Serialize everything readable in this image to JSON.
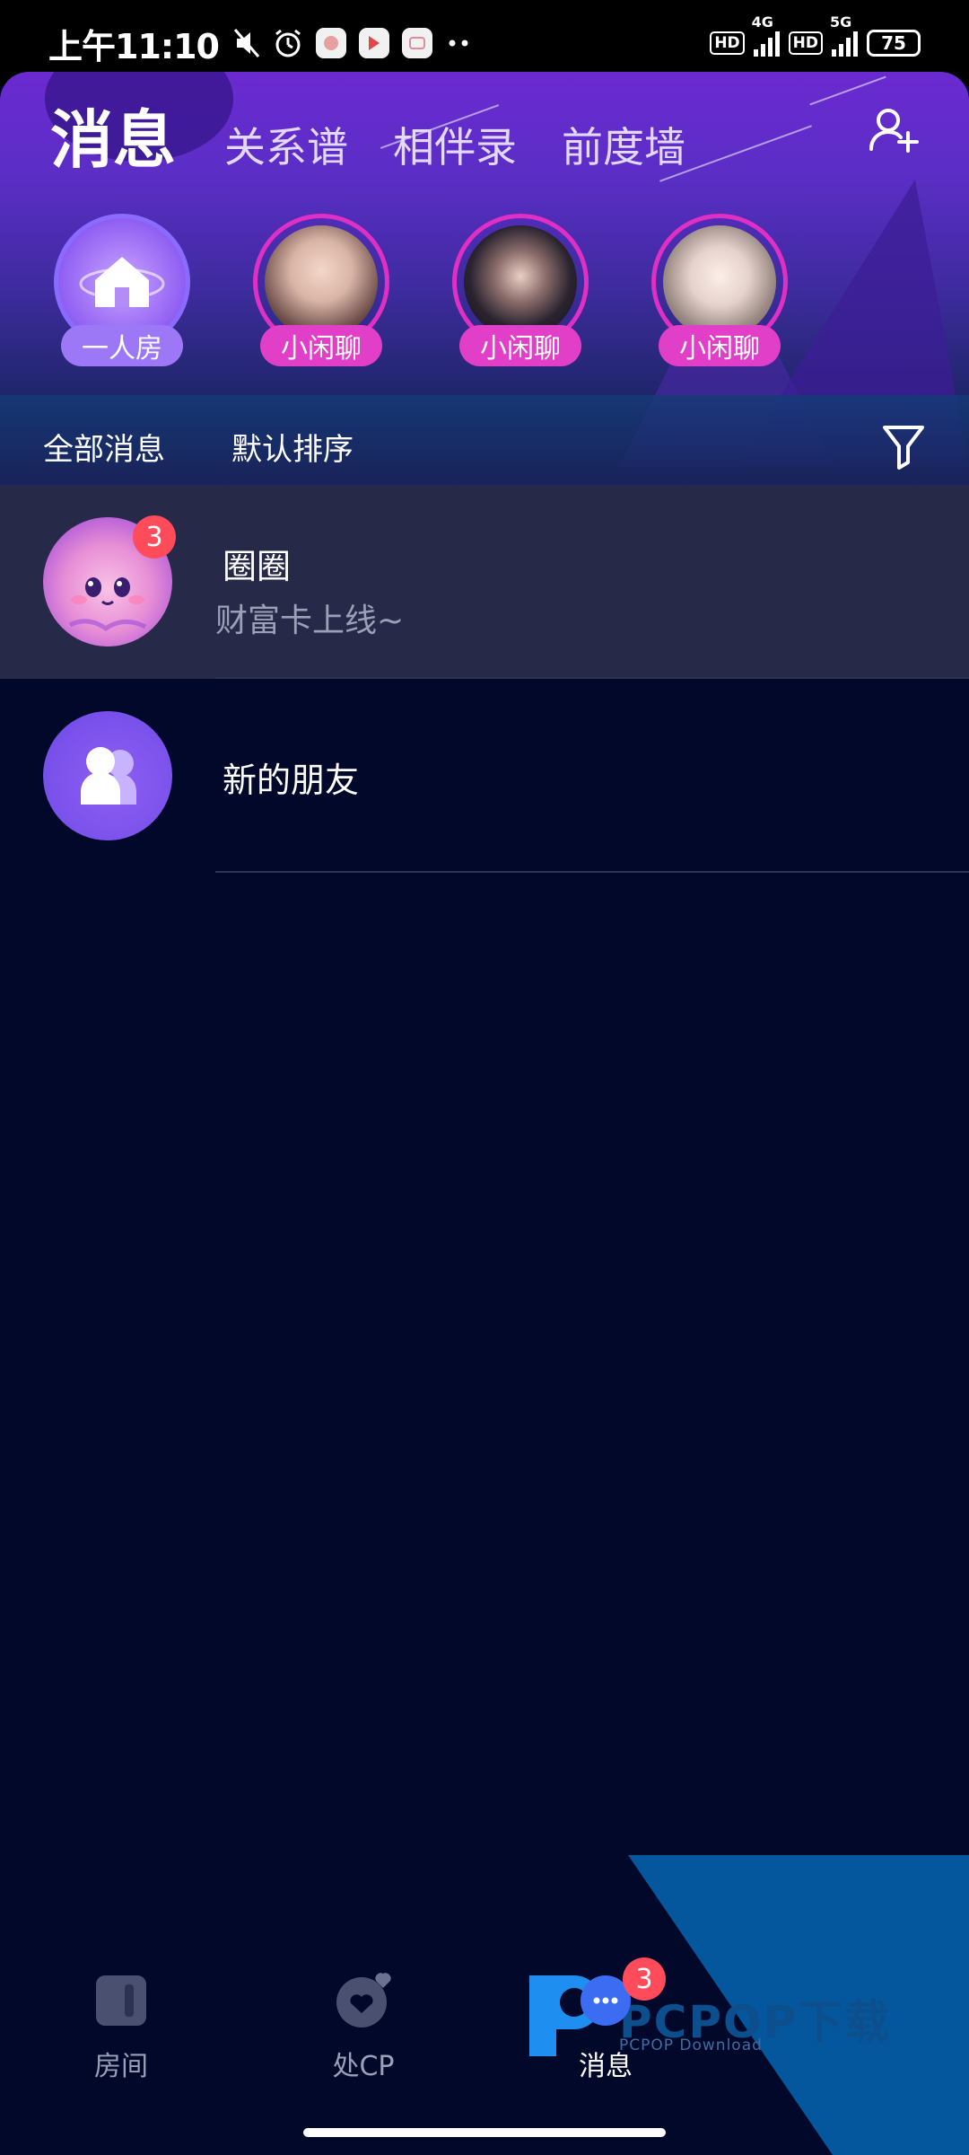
{
  "status_bar": {
    "time": "上午11:10",
    "battery": "75",
    "network_1": "4G",
    "network_2": "5G",
    "hd": "HD"
  },
  "header": {
    "tabs": [
      {
        "label": "消息",
        "active": true
      },
      {
        "label": "关系谱",
        "active": false
      },
      {
        "label": "相伴录",
        "active": false
      },
      {
        "label": "前度墙",
        "active": false
      }
    ],
    "add_friend_icon": "add-user-icon"
  },
  "rooms": [
    {
      "label": "一人房",
      "type": "home"
    },
    {
      "label": "小闲聊",
      "type": "chat"
    },
    {
      "label": "小闲聊",
      "type": "chat"
    },
    {
      "label": "小闲聊",
      "type": "chat"
    }
  ],
  "sort_bar": {
    "all_messages": "全部消息",
    "default_sort": "默认排序",
    "filter_icon": "filter-icon"
  },
  "messages": [
    {
      "name": "圈圈",
      "preview": "财富卡上线~",
      "badge": "3"
    },
    {
      "name": "新的朋友",
      "preview": ""
    }
  ],
  "bottom_nav": [
    {
      "label": "房间",
      "icon": "room-icon",
      "active": false
    },
    {
      "label": "处CP",
      "icon": "heart-icon",
      "active": false
    },
    {
      "label": "消息",
      "icon": "message-icon",
      "active": true,
      "badge": "3"
    }
  ],
  "watermark": {
    "title": "PCPOP下载",
    "subtitle": "PCPOP Download"
  },
  "colors": {
    "background": "#02082a",
    "accent_pink": "#e23fc8",
    "accent_purple": "#8f5ef2",
    "badge_red": "#ff4b5a"
  }
}
